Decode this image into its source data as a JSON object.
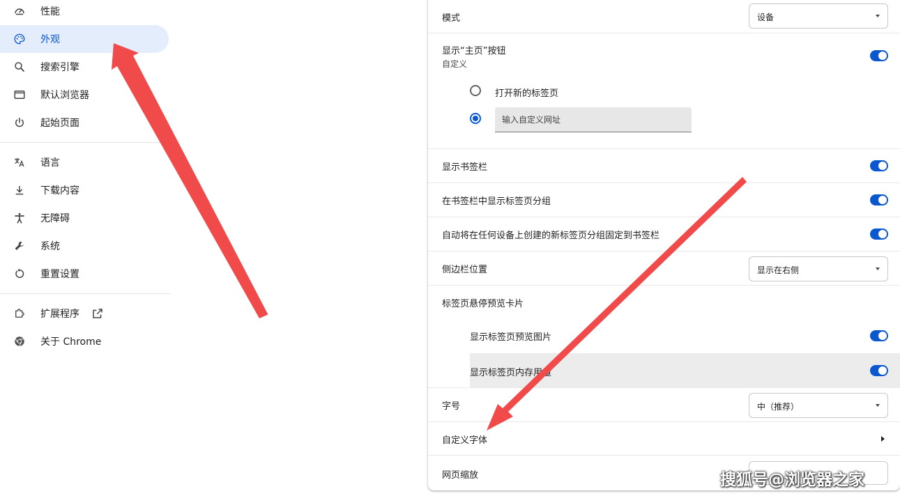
{
  "sidebar": {
    "items": [
      {
        "label": "性能",
        "icon": "speedometer-icon"
      },
      {
        "label": "外观",
        "icon": "palette-icon",
        "active": true
      },
      {
        "label": "搜索引擎",
        "icon": "search-icon"
      },
      {
        "label": "默认浏览器",
        "icon": "browser-window-icon"
      },
      {
        "label": "起始页面",
        "icon": "power-icon"
      },
      {
        "label": "语言",
        "icon": "translate-icon"
      },
      {
        "label": "下载内容",
        "icon": "download-icon"
      },
      {
        "label": "无障碍",
        "icon": "accessibility-icon"
      },
      {
        "label": "系统",
        "icon": "wrench-icon"
      },
      {
        "label": "重置设置",
        "icon": "reset-icon"
      },
      {
        "label": "扩展程序",
        "icon": "puzzle-icon",
        "trailing_icon": "open-external-icon"
      },
      {
        "label": "关于 Chrome",
        "icon": "chrome-icon"
      }
    ]
  },
  "settings": {
    "mode": {
      "label": "模式",
      "value": "设备"
    },
    "home_button": {
      "label": "显示“主页”按钮",
      "sublabel": "自定义",
      "enabled": true,
      "options": [
        {
          "label": "打开新的标签页",
          "checked": false
        },
        {
          "placeholder": "输入自定义网址",
          "checked": true
        }
      ]
    },
    "bookmarks_bar": {
      "label": "显示书签栏",
      "enabled": true
    },
    "tab_groups_in_bookmarks": {
      "label": "在书签栏中显示标签页分组",
      "enabled": true
    },
    "auto_pin_tab_groups": {
      "label": "自动将在任何设备上创建的新标签页分组固定到书签栏",
      "enabled": true
    },
    "side_panel_position": {
      "label": "侧边栏位置",
      "value": "显示在右侧"
    },
    "tab_hover_cards": {
      "label": "标签页悬停预览卡片",
      "preview_images": {
        "label": "显示标签页预览图片",
        "enabled": true
      },
      "memory_usage": {
        "label": "显示标签页内存用量",
        "enabled": true
      }
    },
    "font_size": {
      "label": "字号",
      "value": "中（推荐）"
    },
    "custom_fonts": {
      "label": "自定义字体"
    },
    "page_zoom": {
      "label": "网页缩放"
    }
  },
  "colors": {
    "accent": "#0b57d0",
    "active_nav_bg": "#e4edfc",
    "annotation_arrow": "#f04a4a"
  },
  "watermark": "搜狐号@浏览器之家"
}
